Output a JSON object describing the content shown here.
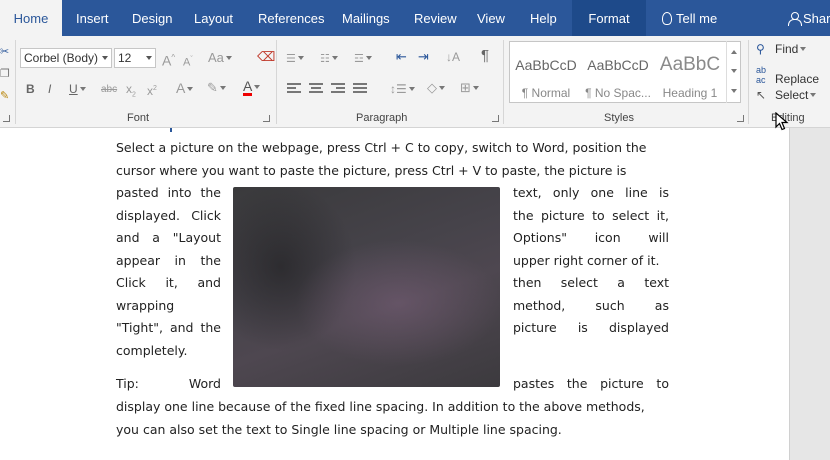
{
  "tabs": [
    "Home",
    "Insert",
    "Design",
    "Layout",
    "References",
    "Mailings",
    "Review",
    "View",
    "Help",
    "Format"
  ],
  "tell_me": "Tell me",
  "share": "Shar",
  "font": {
    "name": "Corbel (Body)",
    "size": "12",
    "label": "Font",
    "grow": "A",
    "shrink": "A",
    "bold": "B",
    "italic": "I",
    "underline": "U",
    "strike": "abc",
    "subscript": "x",
    "sub_2": "2",
    "superscript": "x",
    "sup_2": "2",
    "text_effects": "A",
    "font_color": "A"
  },
  "paragraph": {
    "label": "Paragraph",
    "pilcrow": "¶"
  },
  "styles": {
    "label": "Styles",
    "items": [
      {
        "preview": "AaBbCcD",
        "name": "¶ Normal"
      },
      {
        "preview": "AaBbCcD",
        "name": "¶ No Spac..."
      },
      {
        "preview": "AaBbC",
        "name": "Heading 1"
      }
    ]
  },
  "editing": {
    "find": "Find",
    "replace": "Replace",
    "select": "Select",
    "label": "Editing"
  },
  "document": {
    "para1_line1": "Select a picture on the webpage, press Ctrl + C to copy, switch to Word, position the",
    "para1_line2": "cursor where you want to paste the picture, press Ctrl + V to paste, the picture is",
    "left_lines": [
      [
        "pasted",
        "into",
        "the"
      ],
      [
        "displayed.",
        "Click"
      ],
      [
        "and",
        "a",
        "\"Layout"
      ],
      [
        "appear",
        "in",
        "the"
      ],
      [
        "Click",
        "it,",
        "and"
      ],
      [
        "wrapping"
      ],
      [
        "\"Tight\",",
        "and",
        "the"
      ],
      [
        "completely."
      ]
    ],
    "right_lines": [
      [
        "text,",
        "only",
        "one",
        "line",
        "is"
      ],
      [
        "the",
        "picture",
        "to",
        "select",
        "it,"
      ],
      [
        "Options\"",
        "icon",
        "will"
      ],
      [
        "upper right corner of it."
      ],
      [
        "then",
        "select",
        "a",
        "text"
      ],
      [
        "method,",
        "such",
        "as"
      ],
      [
        "picture",
        "is",
        "displayed"
      ]
    ],
    "tip_left": [
      "Tip:",
      "Word"
    ],
    "tip_right": [
      "pastes",
      "the",
      "picture",
      "to"
    ],
    "tail_line1": "display one line because of the fixed line spacing. In addition to the above methods,",
    "tail_line2": "you can also set the text to Single line spacing or Multiple line spacing."
  }
}
